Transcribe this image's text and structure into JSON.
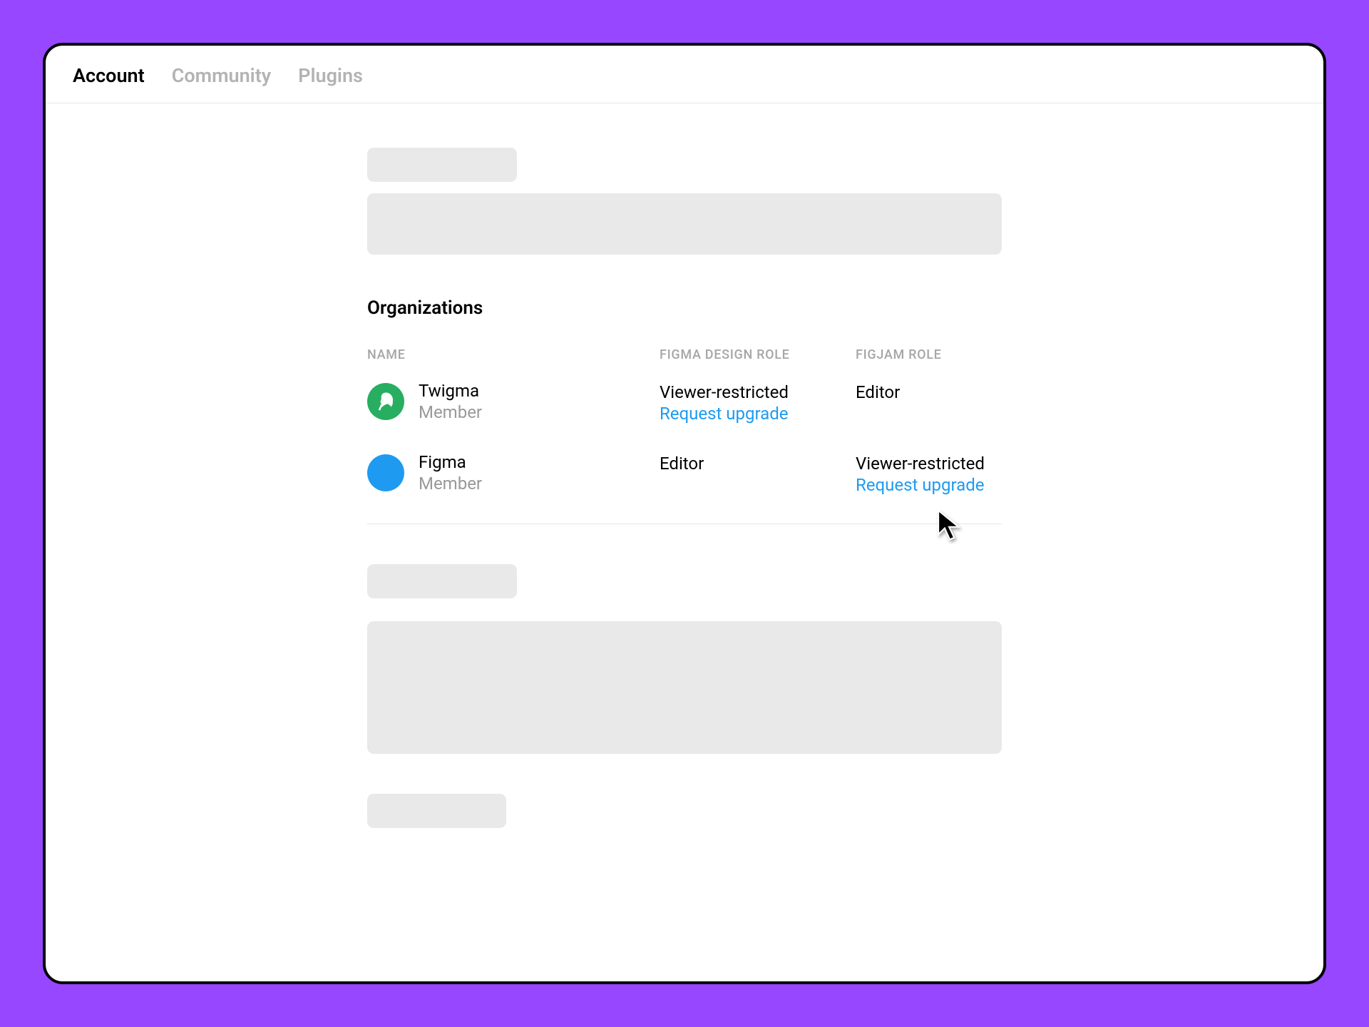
{
  "tabs": {
    "account": "Account",
    "community": "Community",
    "plugins": "Plugins"
  },
  "organizations": {
    "title": "Organizations",
    "headers": {
      "name": "NAME",
      "designRole": "FIGMA DESIGN ROLE",
      "figjamRole": "FIGJAM ROLE"
    },
    "rows": [
      {
        "name": "Twigma",
        "memberRole": "Member",
        "avatarColor": "#27AE60",
        "avatarIcon": "leaf",
        "designRole": "Viewer-restricted",
        "designUpgrade": "Request upgrade",
        "figjamRole": "Editor",
        "figjamUpgrade": ""
      },
      {
        "name": "Figma",
        "memberRole": "Member",
        "avatarColor": "#1E9BF0",
        "avatarIcon": "",
        "designRole": "Editor",
        "designUpgrade": "",
        "figjamRole": "Viewer-restricted",
        "figjamUpgrade": "Request upgrade"
      }
    ]
  },
  "colors": {
    "background": "#9747FF",
    "link": "#1E9BF0",
    "placeholder": "#E9E9E9",
    "muted": "#A6A6A6"
  }
}
